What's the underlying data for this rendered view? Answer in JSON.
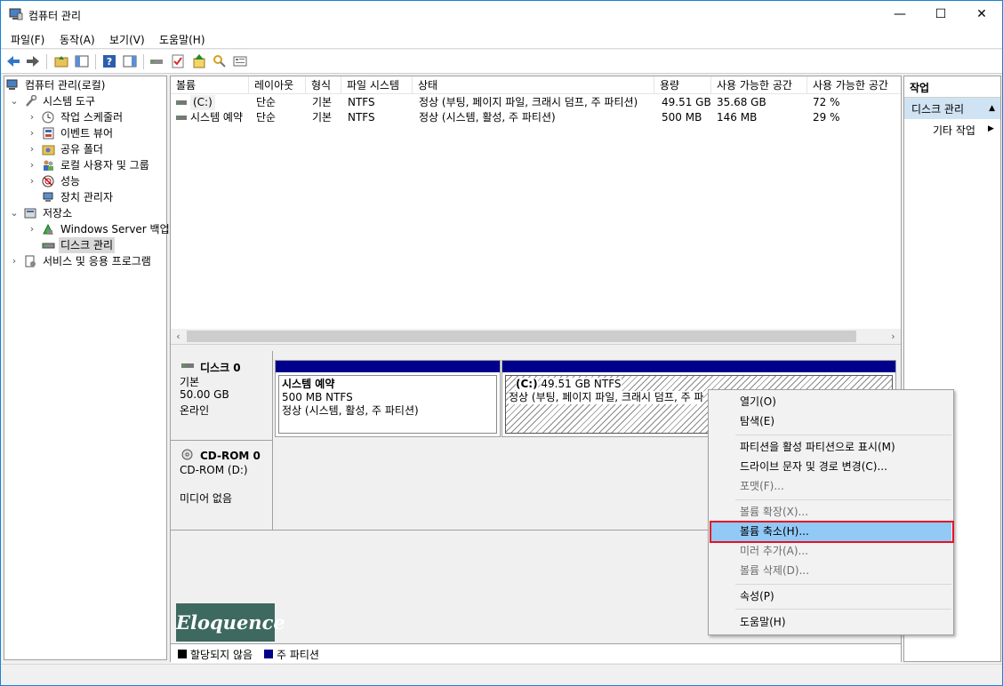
{
  "window": {
    "title": "컴퓨터 관리",
    "minimize": "—",
    "maximize": "☐",
    "close": "✕"
  },
  "menu": [
    "파일(F)",
    "동작(A)",
    "보기(V)",
    "도움말(H)"
  ],
  "tree": {
    "root": "컴퓨터 관리(로컬)",
    "system_tools": "시스템 도구",
    "task_scheduler": "작업 스케줄러",
    "event_viewer": "이벤트 뷰어",
    "shared_folders": "공유 폴더",
    "local_users": "로컬 사용자 및 그룹",
    "performance": "성능",
    "device_manager": "장치 관리자",
    "storage": "저장소",
    "windows_backup": "Windows Server 백업",
    "disk_management": "디스크 관리",
    "services_apps": "서비스 및 응용 프로그램"
  },
  "volume_list": {
    "columns": [
      "볼륨",
      "레이아웃",
      "형식",
      "파일 시스템",
      "상태",
      "용량",
      "사용 가능한 공간",
      "사용 가능한 공간"
    ],
    "rows": [
      {
        "volume": "(C:)",
        "layout": "단순",
        "type": "기본",
        "fs": "NTFS",
        "status": "정상 (부팅, 페이지 파일, 크래시 덤프, 주 파티션)",
        "capacity": "49.51 GB",
        "free": "35.68 GB",
        "free_pct": "72 %"
      },
      {
        "volume": "시스템 예약",
        "layout": "단순",
        "type": "기본",
        "fs": "NTFS",
        "status": "정상 (시스템, 활성, 주 파티션)",
        "capacity": "500 MB",
        "free": "146 MB",
        "free_pct": "29 %"
      }
    ]
  },
  "disk0": {
    "name": "디스크 0",
    "type": "기본",
    "size": "50.00 GB",
    "state": "온라인",
    "partitions": [
      {
        "title": "시스템 예약",
        "size": "500 MB NTFS",
        "status": "정상 (시스템, 활성, 주 파티션)"
      },
      {
        "title": "(C:)",
        "size": "49.51 GB NTFS",
        "status": "정상 (부팅, 페이지 파일, 크래시 덤프, 주 파"
      }
    ]
  },
  "cdrom0": {
    "name": "CD-ROM 0",
    "drive": "CD-ROM (D:)",
    "state": "미디어 없음"
  },
  "legend": {
    "unallocated": "할당되지 않음",
    "primary": "주 파티션"
  },
  "actions": {
    "header": "작업",
    "selected": "디스크 관리",
    "more": "기타 작업"
  },
  "context_menu": {
    "open": "열기(O)",
    "explore": "탐색(E)",
    "mark_active": "파티션을 활성 파티션으로 표시(M)",
    "change_letter": "드라이브 문자 및 경로 변경(C)...",
    "format": "포맷(F)...",
    "extend": "볼륨 확장(X)...",
    "shrink": "볼륨 축소(H)...",
    "add_mirror": "미러 추가(A)...",
    "delete": "볼륨 삭제(D)...",
    "properties": "속성(P)",
    "help": "도움말(H)"
  },
  "watermark": "Eloquence",
  "colors": {
    "primary_partition": "#00008b",
    "highlight": "#91c9f7",
    "red_outline": "#e81123"
  }
}
